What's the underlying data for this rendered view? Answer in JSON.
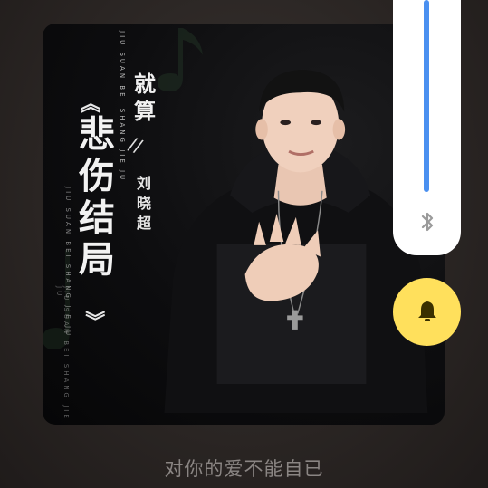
{
  "album": {
    "title": "悲伤结局",
    "subtitle": "就算",
    "artist": "刘晓超",
    "pinyin": "JIU SUAN BEI SHANG JIE JU",
    "quote_open": "《",
    "quote_close": "》",
    "slash": "//"
  },
  "lyrics": {
    "current_line": "对你的爱不能自已"
  },
  "volume_panel": {
    "level_percent": 100,
    "bluetooth_icon": "bluetooth-icon",
    "accent_color": "#4a90f0"
  },
  "ringer_button": {
    "icon": "bell-icon",
    "color": "#ffe05c"
  }
}
